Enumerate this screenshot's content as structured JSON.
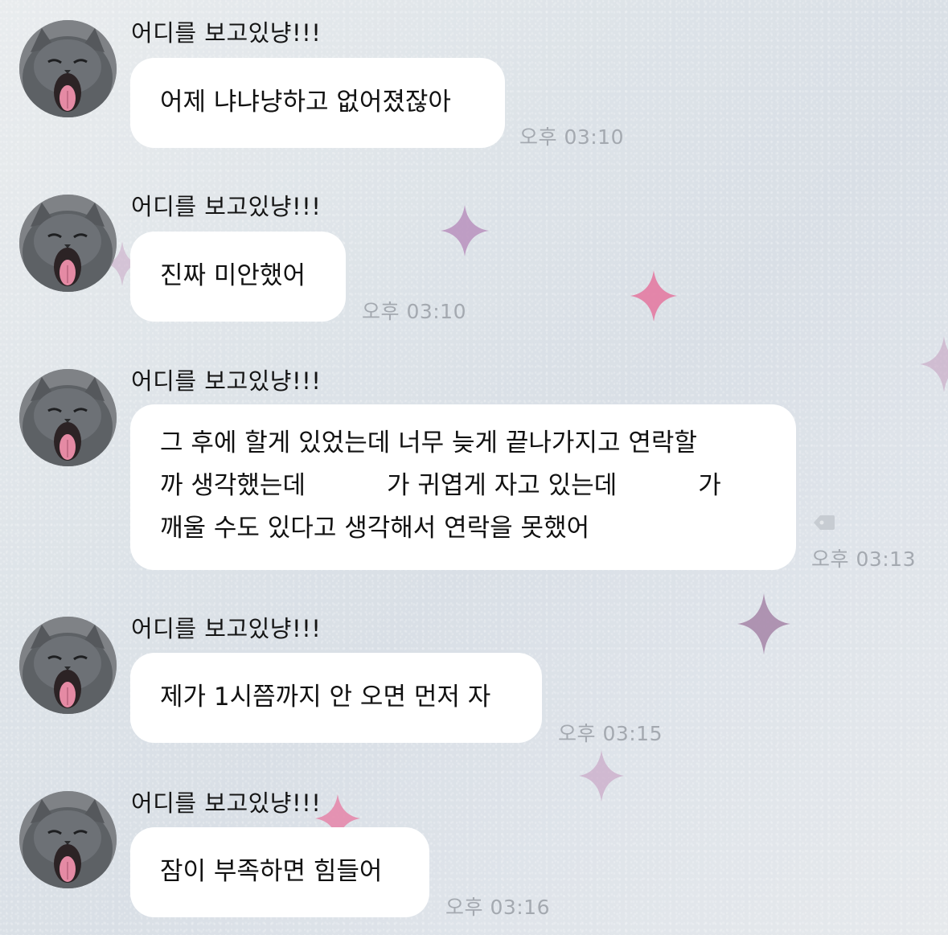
{
  "messages": [
    {
      "sender": "어디를 보고있냥!!!",
      "lines": [
        "어제 냐냐냥하고 없어졌잖아"
      ],
      "time": "오후 03:10",
      "avatar_icon": "cat-avatar-icon"
    },
    {
      "sender": "어디를 보고있냥!!!",
      "lines": [
        "진짜 미안했어"
      ],
      "time": "오후 03:10",
      "avatar_icon": "cat-avatar-icon"
    },
    {
      "sender": "어디를 보고있냥!!!",
      "line1": "그 후에 할게 있었는데 너무 늦게 끝나가지고 연락할",
      "line2_a": "까 생각했는데",
      "line2_b": "가 귀엽게 자고 있는데",
      "line2_c": "가",
      "line3": "깨울 수도 있다고 생각해서 연락을 못했어",
      "time": "오후 03:13",
      "avatar_icon": "cat-avatar-icon"
    },
    {
      "sender": "어디를 보고있냥!!!",
      "lines": [
        "제가 1시쯤까지 안 오면 먼저 자"
      ],
      "time": "오후 03:15",
      "avatar_icon": "cat-avatar-icon"
    },
    {
      "sender": "어디를 보고있냥!!!",
      "lines": [
        "잠이 부족하면 힘들어"
      ],
      "time": "오후 03:16",
      "avatar_icon": "cat-avatar-icon"
    }
  ],
  "colors": {
    "bubble": "#ffffff",
    "text": "#111111",
    "timestamp": "#a4a9b0",
    "sparkle_pink": "#e07aa0",
    "sparkle_purple": "#b58fb5"
  }
}
